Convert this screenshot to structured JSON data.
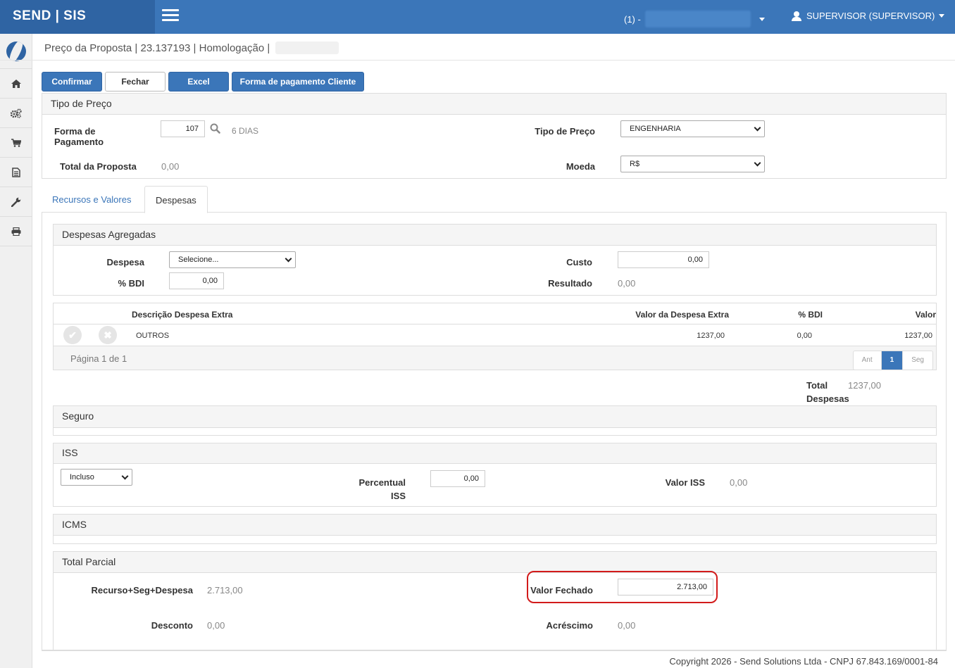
{
  "app": {
    "brand": "SEND | SIS"
  },
  "header": {
    "company_prefix": "(1) -",
    "user_label": "SUPERVISOR (SUPERVISOR)"
  },
  "sidebar": {
    "icons": [
      "home-icon",
      "cogs-icon",
      "cart-icon",
      "document-icon",
      "wrench-icon",
      "print-icon"
    ]
  },
  "page": {
    "title": "Preço da Proposta | 23.137193 | Homologação |"
  },
  "toolbar": {
    "confirm": "Confirmar",
    "close": "Fechar",
    "excel": "Excel",
    "payment": "Forma de pagamento Cliente"
  },
  "tipo_preco_panel": {
    "title": "Tipo de Preço",
    "forma_pagamento_label": "Forma de Pagamento",
    "forma_pagamento_value": "107",
    "forma_pagamento_desc": "6 DIAS",
    "tipo_preco_label": "Tipo de Preço",
    "tipo_preco_value": "ENGENHARIA",
    "total_proposta_label": "Total da Proposta",
    "total_proposta_value": "0,00",
    "moeda_label": "Moeda",
    "moeda_value": "R$"
  },
  "tabs": {
    "recursos": "Recursos e Valores",
    "despesas": "Despesas"
  },
  "despesas_agregadas": {
    "title": "Despesas Agregadas",
    "despesa_label": "Despesa",
    "despesa_value": "Selecione...",
    "custo_label": "Custo",
    "custo_value": "0,00",
    "bdi_label": "% BDI",
    "bdi_value": "0,00",
    "resultado_label": "Resultado",
    "resultado_value": "0,00"
  },
  "grid": {
    "columns": [
      "Descrição Despesa Extra",
      "Valor da Despesa Extra",
      "% BDI",
      "Valor"
    ],
    "rows": [
      {
        "descricao": "OUTROS",
        "valor_despesa": "1237,00",
        "bdi": "0,00",
        "valor": "1237,00"
      }
    ],
    "page_info": "Página 1 de 1",
    "pager": {
      "prev": "Ant",
      "current": "1",
      "next": "Seg"
    }
  },
  "total_despesas": {
    "label_line1": "Total",
    "label_line2": "Despesas",
    "value": "1237,00"
  },
  "seguro": {
    "title": "Seguro"
  },
  "iss": {
    "title": "ISS",
    "mode_value": "Incluso",
    "percentual_label_line1": "Percentual",
    "percentual_label_line2": "ISS",
    "percentual_value": "0,00",
    "valor_label": "Valor ISS",
    "valor_value": "0,00"
  },
  "icms": {
    "title": "ICMS"
  },
  "total_parcial": {
    "title": "Total Parcial",
    "recurso_label": "Recurso+Seg+Despesa",
    "recurso_value": "2.713,00",
    "valor_fechado_label": "Valor Fechado",
    "valor_fechado_value": "2.713,00",
    "desconto_label": "Desconto",
    "desconto_value": "0,00",
    "acrescimo_label": "Acréscimo",
    "acrescimo_value": "0,00"
  },
  "footer": {
    "text": "Copyright 2026 - Send Solutions Ltda - CNPJ 67.843.169/0001-84"
  },
  "colors": {
    "primary": "#3b76b9",
    "brand_dark": "#2f64a3",
    "highlight": "#d21b1b"
  }
}
